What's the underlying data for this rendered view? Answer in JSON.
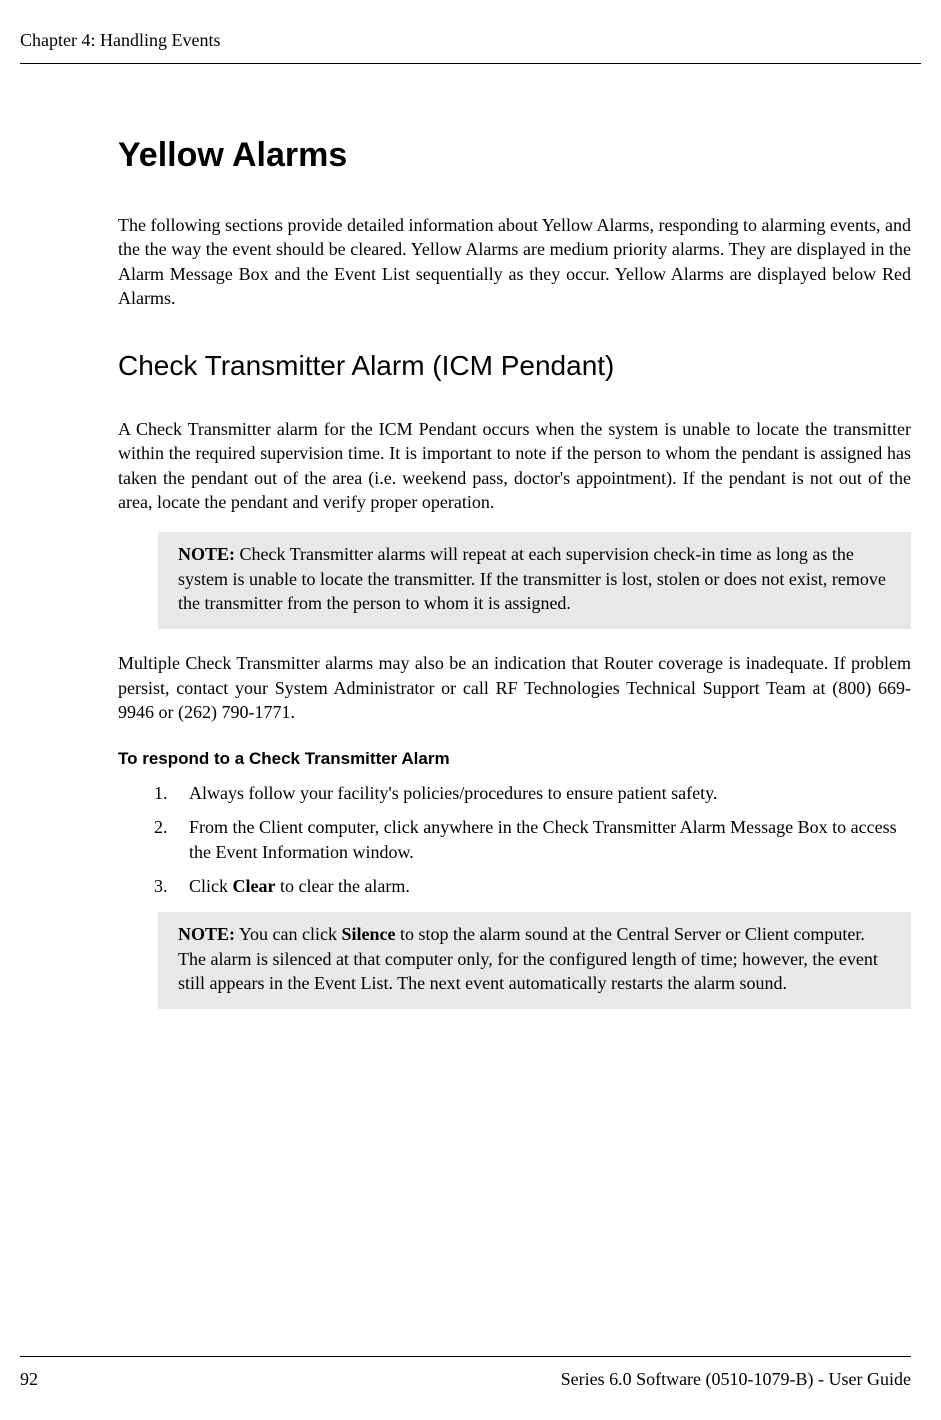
{
  "header": {
    "chapter": "Chapter 4: Handling Events"
  },
  "main": {
    "title": "Yellow Alarms",
    "intro": "The following sections provide detailed information about Yellow Alarms, responding to alarming events, and the the way the event should be cleared. Yellow Alarms are medium priority alarms. They are displayed in the Alarm Message Box and the Event List sequentially as they occur. Yellow Alarms are displayed below Red Alarms.",
    "section_title": "Check Transmitter Alarm (ICM Pendant)",
    "section_para1": "A Check Transmitter alarm for the ICM Pendant occurs when the system is unable to locate the transmitter within the required supervision time. It is important to note if the person to whom the pendant is assigned has taken the pendant out of the area (i.e. weekend pass, doctor's appointment). If the pendant is not out of the area, locate the pendant and verify proper operation.",
    "note1_label": "NOTE:",
    "note1_text": " Check Transmitter alarms will repeat at each supervision check-in time as long as the system is unable to locate the transmitter. If the transmitter is lost, stolen or does not exist, remove the transmitter from the person to whom it is assigned.",
    "section_para2": "Multiple Check Transmitter alarms may also be an indication that Router coverage is inadequate. If problem persist, contact your System Administrator or call RF Technologies Technical Support Team at (800) 669-9946 or (262) 790-1771.",
    "procedure_title": "To respond to a Check Transmitter Alarm",
    "steps": {
      "s1_num": "1.",
      "s1_text": "Always follow your facility's policies/procedures to ensure patient safety.",
      "s2_num": "2.",
      "s2_text": "From the Client computer, click anywhere in the Check Transmitter Alarm Message Box to access the Event Information window.",
      "s3_num": "3.",
      "s3_pre": "Click ",
      "s3_bold": "Clear",
      "s3_post": " to clear the alarm."
    },
    "note2_label": "NOTE:",
    "note2_pre": " You can click ",
    "note2_bold": "Silence",
    "note2_post": " to stop the alarm sound at the Central Server or Client computer. The alarm is silenced at that computer only, for the configured length of time; however, the event still appears in the Event List. The next event automatically restarts the alarm sound."
  },
  "footer": {
    "page_number": "92",
    "doc_title": "Series 6.0 Software (0510-1079-B) - User Guide"
  }
}
